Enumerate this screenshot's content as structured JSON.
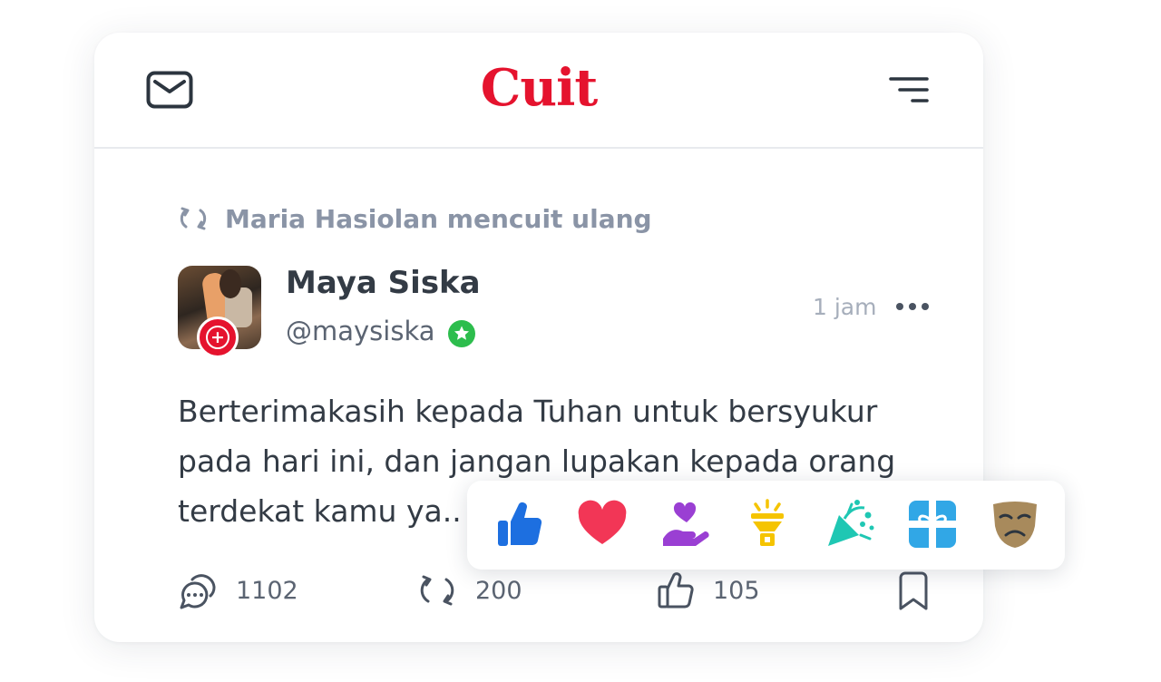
{
  "app": {
    "logo": "Cuit"
  },
  "colors": {
    "brand": "#e5132e",
    "verified": "#2dbd4d",
    "text_muted": "#8a94a6"
  },
  "header": {
    "inbox_icon": "mail-icon",
    "menu_icon": "hamburger-menu-icon"
  },
  "post": {
    "repost_text": "Maria Hasiolan mencuit ulang",
    "author_name": "Maya Siska",
    "author_handle": "@maysiska",
    "time": "1 jam",
    "body": "Berterimakasih kepada Tuhan untuk bersyukur pada hari ini, dan jangan lupakan kepada orang terdekat kamu ya..",
    "stats": {
      "comments": "1102",
      "reposts": "200",
      "likes": "105"
    }
  },
  "reactions": [
    "thumbs-up",
    "heart",
    "care-hand-heart",
    "insightful-lamp",
    "celebrate-party-popper",
    "gift",
    "sad-mask"
  ]
}
